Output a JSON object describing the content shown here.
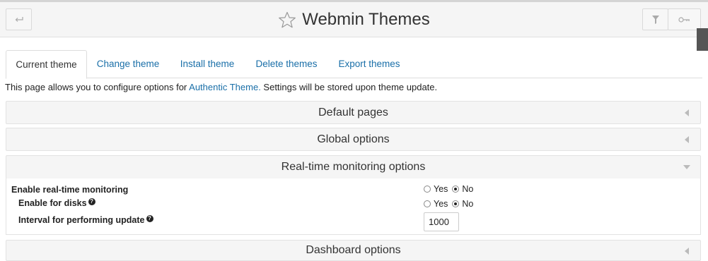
{
  "header": {
    "title": "Webmin Themes",
    "back_icon": "return-arrow-icon",
    "star_icon": "star-outline-icon",
    "filter_icon": "filter-icon",
    "key_icon": "key-icon"
  },
  "tabs": [
    {
      "label": "Current theme",
      "active": true
    },
    {
      "label": "Change theme",
      "active": false
    },
    {
      "label": "Install theme",
      "active": false
    },
    {
      "label": "Delete themes",
      "active": false
    },
    {
      "label": "Export themes",
      "active": false
    }
  ],
  "intro": {
    "before": "This page allows you to configure options for ",
    "link": "Authentic Theme.",
    "after": " Settings will be stored upon theme update."
  },
  "panels": {
    "default_pages": "Default pages",
    "global_options": "Global options",
    "realtime": "Real-time monitoring options",
    "dashboard": "Dashboard options"
  },
  "realtime_options": {
    "enable_monitoring": {
      "label": "Enable real-time monitoring",
      "yes": "Yes",
      "no": "No",
      "selected": "No"
    },
    "enable_disks": {
      "label": "Enable for disks",
      "yes": "Yes",
      "no": "No",
      "selected": "No"
    },
    "interval": {
      "label": "Interval for performing update",
      "value": "1000"
    }
  },
  "colors": {
    "link": "#1a6fa8",
    "header_bg": "#f5f5f5",
    "panel_bg": "#f5f5f5"
  }
}
